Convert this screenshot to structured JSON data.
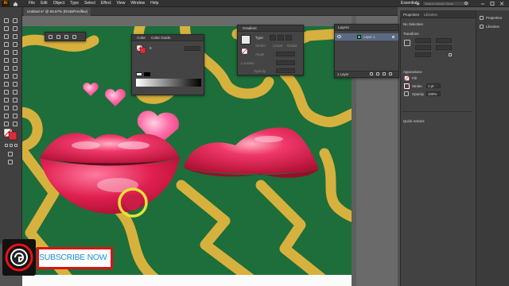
{
  "app": {
    "logo": "Ai",
    "home_icon": "home-icon"
  },
  "menu": {
    "items": [
      "File",
      "Edit",
      "Object",
      "Type",
      "Select",
      "Effect",
      "View",
      "Window",
      "Help"
    ]
  },
  "workspace": {
    "label": "Essentials",
    "search_placeholder": "Search Adobe Stock"
  },
  "document": {
    "tab_title": "Untitled-4* @ 66.67% (RGB/Preview)",
    "close_symbol": "×"
  },
  "color_panel": {
    "tabs": [
      "Color",
      "Color Guide"
    ],
    "value": "0"
  },
  "gradient_panel": {
    "title": "Gradient",
    "type_label": "Type:",
    "stroke_label": "Stroke:",
    "angle_label": "Angle",
    "location_label": "Location",
    "opacity_label": "Opacity",
    "option_a": "Linear",
    "option_b": "Radial"
  },
  "layers_panel": {
    "title": "Layers",
    "layer_name": "Layer 1",
    "footer": "1 Layer"
  },
  "properties_panel": {
    "tabs": [
      "Properties",
      "Libraries"
    ],
    "selection": "No Selection",
    "transform_title": "Transform",
    "appearance_title": "Appearance",
    "fill_label": "Fill",
    "stroke_label": "Stroke",
    "stroke_value": "1 pt",
    "opacity_label": "Opacity",
    "opacity_value": "100%",
    "quick_actions": "Quick Actions"
  },
  "side_dock": {
    "items": [
      "Properties",
      "Libraries"
    ]
  },
  "overlay": {
    "subscribe_text": "SUBSCRIBE NOW"
  },
  "colors": {
    "canvas_green": "#1d6e3a",
    "ribbon_gold": "#d7b13e",
    "lip_red": "#e3204a",
    "heart_pink": "#ff6fa8",
    "subscribe_red": "#dd1111",
    "subscribe_blue": "#1d8fd6"
  }
}
